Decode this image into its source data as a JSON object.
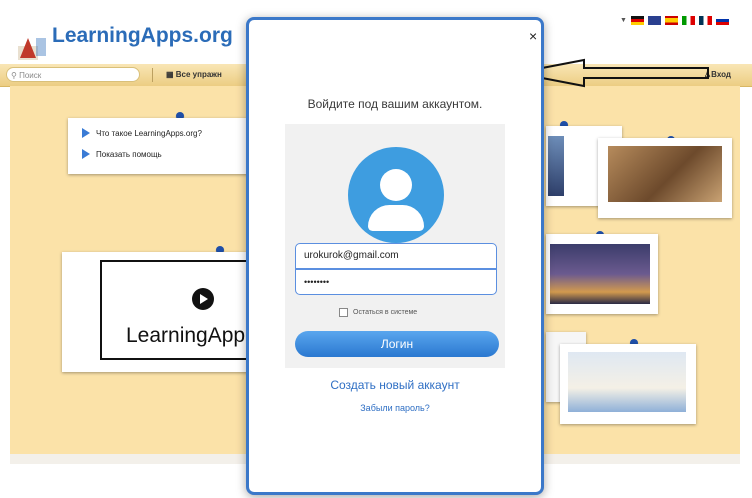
{
  "header": {
    "logo_text": "LearningApps.org"
  },
  "toolbar": {
    "search_placeholder": "Поиск",
    "all_exercises_label": "Все упражн",
    "login_label": "Вход"
  },
  "board": {
    "help_items": [
      "Что такое LearningApps.org?",
      "Показать помощь"
    ],
    "video_caption": "LearningApp"
  },
  "dialog": {
    "title": "Войдите под вашим аккаунтом.",
    "email_value": "urokurok@gmail.com",
    "password_masked": "••••••••",
    "remember_label": "Остаться в системе",
    "remember_checked": false,
    "login_button": "Логин",
    "create_account": "Создать новый аккаунт",
    "forgot_password": "Забыли пароль?",
    "close_glyph": "×"
  },
  "colors": {
    "accent": "#3b78c9",
    "avatar": "#3e9de0",
    "board": "#fbe2a8"
  },
  "icons": [
    "search-icon",
    "grid-icon",
    "user-icon",
    "close-icon",
    "avatar-icon",
    "play-icon",
    "arrow-icon"
  ]
}
